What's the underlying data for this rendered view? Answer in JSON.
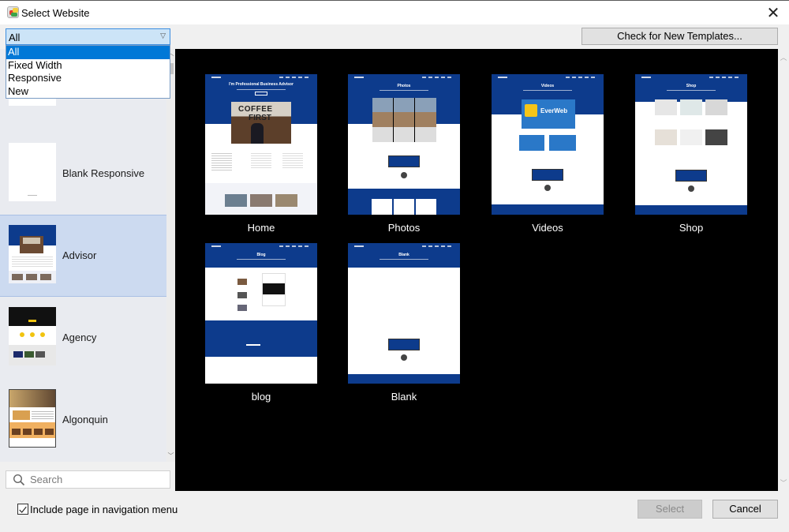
{
  "window": {
    "title": "Select Website",
    "close_icon": "close-icon"
  },
  "filter": {
    "selected": "All",
    "options": [
      "All",
      "Fixed Width",
      "Responsive",
      "New"
    ],
    "highlighted_index": 0
  },
  "templates": {
    "items": [
      {
        "label": "",
        "thumbnail": "blank-fixed"
      },
      {
        "label": "Blank Responsive",
        "thumbnail": "blank-responsive"
      },
      {
        "label": "Advisor",
        "thumbnail": "advisor",
        "selected": true
      },
      {
        "label": "Agency",
        "thumbnail": "agency"
      },
      {
        "label": "Algonquin",
        "thumbnail": "algonquin"
      }
    ]
  },
  "toolbar": {
    "check_templates_label": "Check for New Templates..."
  },
  "pages": [
    {
      "name": "Home",
      "heading": "I'm Professional Business Advisor"
    },
    {
      "name": "Photos",
      "heading": "Photos"
    },
    {
      "name": "Videos",
      "heading": "Videos"
    },
    {
      "name": "Shop",
      "heading": "Shop"
    },
    {
      "name": "blog",
      "heading": "Blog"
    },
    {
      "name": "Blank",
      "heading": "Blank"
    }
  ],
  "search": {
    "placeholder": "Search",
    "value": ""
  },
  "options": {
    "include_nav_label": "Include page in navigation menu",
    "include_nav_checked": true
  },
  "actions": {
    "select_label": "Select",
    "select_enabled": false,
    "cancel_label": "Cancel"
  },
  "colors": {
    "template_blue": "#0d3b8c",
    "selection_blue": "#0078d7",
    "list_selected": "#ccdaf0"
  }
}
